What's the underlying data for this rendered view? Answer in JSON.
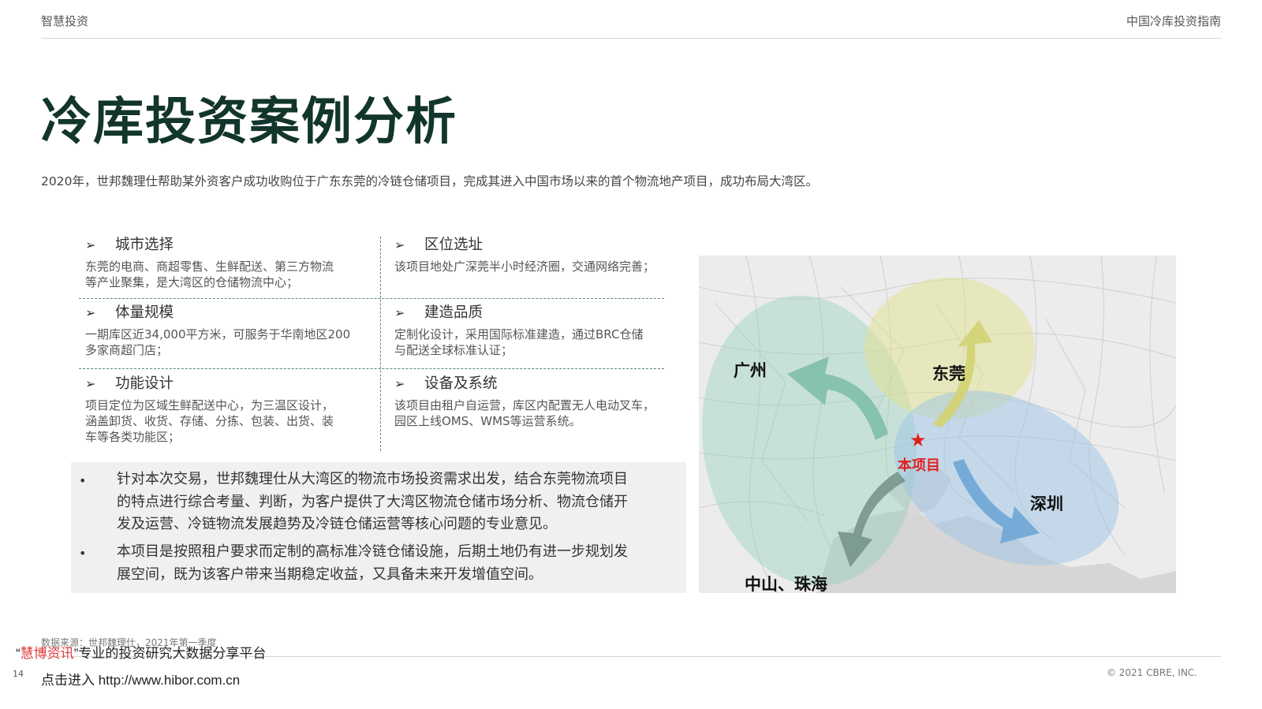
{
  "header": {
    "left": "智慧投资",
    "right": "中国冷库投资指南"
  },
  "title": "冷库投资案例分析",
  "intro": "2020年，世邦魏理仕帮助某外资客户成功收购位于广东东莞的冷链仓储项目，完成其进入中国市场以来的首个物流地产项目，成功布局大湾区。",
  "sections": [
    {
      "arrow": "➢",
      "title": "城市选择",
      "lines": [
        "东莞的电商、商超零售、生鲜配送、第三方物流",
        "等产业聚集，是大湾区的仓储物流中心；"
      ]
    },
    {
      "arrow": "➢",
      "title": "区位选址",
      "lines": [
        "该项目地处广深莞半小时经济圈，交通网络完善；"
      ]
    },
    {
      "arrow": "➢",
      "title": "体量规模",
      "lines": [
        "一期库区近34,000平方米，可服务于华南地区200",
        "多家商超门店；"
      ]
    },
    {
      "arrow": "➢",
      "title": "建造品质",
      "lines": [
        "定制化设计，采用国际标准建造，通过BRC仓储",
        "与配送全球标准认证；"
      ]
    },
    {
      "arrow": "➢",
      "title": "功能设计",
      "lines": [
        "项目定位为区域生鲜配送中心，为三温区设计，",
        "涵盖卸货、收货、存储、分拣、包装、出货、装",
        "车等各类功能区；"
      ]
    },
    {
      "arrow": "➢",
      "title": "设备及系统",
      "lines": [
        "该项目由租户自运营，库区内配置无人电动叉车，",
        "园区上线OMS、WMS等运营系统。"
      ]
    }
  ],
  "summary": [
    {
      "bullet": "•",
      "lines": [
        "针对本次交易，世邦魏理仕从大湾区的物流市场投资需求出发，结合东莞物流项目",
        "的特点进行综合考量、判断，为客户提供了大湾区物流仓储市场分析、物流仓储开",
        "发及运营、冷链物流发展趋势及冷链仓储运营等核心问题的专业意见。"
      ]
    },
    {
      "bullet": "•",
      "lines": [
        "本项目是按照租户要求而定制的高标准冷链仓储设施，后期土地仍有进一步规划发",
        "展空间，既为该客户带来当期稳定收益，又具备未来开发增值空间。"
      ]
    }
  ],
  "map": {
    "labels": {
      "guangzhou": "广州",
      "dongguan": "东莞",
      "shenzhen": "深圳",
      "zhongshan": "中山、珠海",
      "project": "本项目"
    },
    "star": "★",
    "colors": {
      "guangzhou": "#7fbfa8",
      "dongguan": "#d8d98f",
      "shenzhen": "#8db8db",
      "zhongshan": "#6e8c84",
      "project": "#e02020"
    }
  },
  "footer": {
    "source": "数据来源：世邦魏理仕，2021年第一季度",
    "watermark_line1_prefix": "“",
    "watermark_brand": "慧博资讯",
    "watermark_line1_suffix": "”专业的投资研究大数据分享平台",
    "watermark_line2": "点击进入 http://www.hibor.com.cn",
    "page": "14",
    "copyright": "© 2021 CBRE, INC."
  }
}
